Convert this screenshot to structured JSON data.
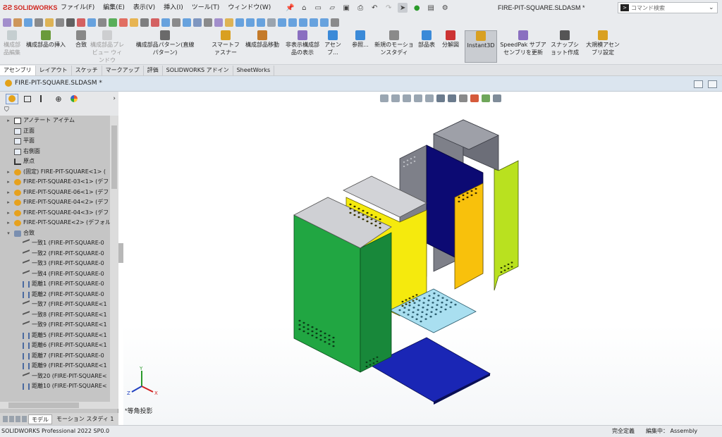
{
  "app": {
    "brand": "SOLIDWORKS",
    "doc_title": "FIRE-PIT-SQUARE.SLDASM *",
    "menus": [
      "ファイル(F)",
      "編集(E)",
      "表示(V)",
      "挿入(I)",
      "ツール(T)",
      "ウィンドウ(W)"
    ],
    "search_placeholder": "コマンド検索",
    "search_prefix": ">"
  },
  "command_manager": {
    "buttons": [
      {
        "label": "構成部品編集",
        "disabled": true
      },
      {
        "label": "構成部品の挿入",
        "disabled": false
      },
      {
        "label": "合致",
        "disabled": false
      },
      {
        "label": "構成部品プレビュー ウィンドウ",
        "disabled": true
      },
      {
        "label": "構成部品パターン(直線パターン)",
        "disabled": false
      },
      {
        "label": "スマートファスナー",
        "disabled": false
      },
      {
        "label": "構成部品移動",
        "disabled": false
      },
      {
        "label": "非表示構成部品の表示",
        "disabled": false
      },
      {
        "label": "アセンブ...",
        "disabled": false
      },
      {
        "label": "参照...",
        "disabled": false
      },
      {
        "label": "新規のモーションスタディ",
        "disabled": false
      },
      {
        "label": "部品表",
        "disabled": false
      },
      {
        "label": "分解図",
        "disabled": false
      },
      {
        "label": "Instant3D",
        "disabled": false,
        "active": true
      },
      {
        "label": "SpeedPak サブアセンブリを更新",
        "disabled": false
      },
      {
        "label": "スナップショット作成",
        "disabled": false
      },
      {
        "label": "大規模アセンブリ設定",
        "disabled": false
      }
    ],
    "tabs": [
      "アセンブリ",
      "レイアウト",
      "スケッチ",
      "マークアップ",
      "評価",
      "SOLIDWORKS アドイン",
      "SheetWorks"
    ],
    "active_tab": "アセンブリ"
  },
  "document_tab": {
    "label": "FIRE-PIT-SQUARE.SLDASM *"
  },
  "tree": {
    "items": [
      {
        "label": "アノテート アイテム",
        "level": 0,
        "expand": "▸",
        "icon": "annotation-icon"
      },
      {
        "label": "正面",
        "level": 0,
        "expand": "",
        "icon": "plane-icon"
      },
      {
        "label": "平面",
        "level": 0,
        "expand": "",
        "icon": "plane-icon"
      },
      {
        "label": "右側面",
        "level": 0,
        "expand": "",
        "icon": "plane-icon"
      },
      {
        "label": "原点",
        "level": 0,
        "expand": "",
        "icon": "origin-icon"
      },
      {
        "label": "(固定) FIRE-PIT-SQUARE<1> (",
        "level": 0,
        "expand": "▸",
        "icon": "part-icon"
      },
      {
        "label": "FIRE-PIT-SQUARE-03<1> (デフ",
        "level": 0,
        "expand": "▸",
        "icon": "part-icon"
      },
      {
        "label": "FIRE-PIT-SQUARE-06<1> (デフ",
        "level": 0,
        "expand": "▸",
        "icon": "part-icon"
      },
      {
        "label": "FIRE-PIT-SQUARE-04<2> (デフ",
        "level": 0,
        "expand": "▸",
        "icon": "part-icon"
      },
      {
        "label": "FIRE-PIT-SQUARE-04<3> (デフ",
        "level": 0,
        "expand": "▸",
        "icon": "part-icon"
      },
      {
        "label": "FIRE-PIT-SQUARE<2> (デフォルト",
        "level": 0,
        "expand": "▸",
        "icon": "part-icon"
      },
      {
        "label": "合致",
        "level": 0,
        "expand": "▾",
        "icon": "mates-icon"
      },
      {
        "label": "一致1 (FIRE-PIT-SQUARE-0",
        "level": 1,
        "expand": "",
        "icon": "coincident-icon"
      },
      {
        "label": "一致2 (FIRE-PIT-SQUARE-0",
        "level": 1,
        "expand": "",
        "icon": "coincident-icon"
      },
      {
        "label": "一致3 (FIRE-PIT-SQUARE-0",
        "level": 1,
        "expand": "",
        "icon": "coincident-icon"
      },
      {
        "label": "一致4 (FIRE-PIT-SQUARE-0",
        "level": 1,
        "expand": "",
        "icon": "coincident-icon"
      },
      {
        "label": "距離1 (FIRE-PIT-SQUARE-0",
        "level": 1,
        "expand": "",
        "icon": "distance-icon"
      },
      {
        "label": "距離2 (FIRE-PIT-SQUARE-0",
        "level": 1,
        "expand": "",
        "icon": "distance-icon"
      },
      {
        "label": "一致7 (FIRE-PIT-SQUARE<1",
        "level": 1,
        "expand": "",
        "icon": "coincident-icon"
      },
      {
        "label": "一致8 (FIRE-PIT-SQUARE<1",
        "level": 1,
        "expand": "",
        "icon": "coincident-icon"
      },
      {
        "label": "一致9 (FIRE-PIT-SQUARE<1",
        "level": 1,
        "expand": "",
        "icon": "coincident-icon"
      },
      {
        "label": "距離5 (FIRE-PIT-SQUARE<1",
        "level": 1,
        "expand": "",
        "icon": "distance-icon"
      },
      {
        "label": "距離6 (FIRE-PIT-SQUARE<1",
        "level": 1,
        "expand": "",
        "icon": "distance-icon"
      },
      {
        "label": "距離7 (FIRE-PIT-SQUARE-0",
        "level": 1,
        "expand": "",
        "icon": "distance-icon"
      },
      {
        "label": "距離9 (FIRE-PIT-SQUARE<1",
        "level": 1,
        "expand": "",
        "icon": "distance-icon"
      },
      {
        "label": "一致20 (FIRE-PIT-SQUARE<",
        "level": 1,
        "expand": "",
        "icon": "coincident-icon"
      },
      {
        "label": "距離10 (FIRE-PIT-SQUARE<",
        "level": 1,
        "expand": "",
        "icon": "distance-icon"
      }
    ]
  },
  "bottom_tabs": [
    "モデル",
    "モーション スタディ 1"
  ],
  "viewport": {
    "view_label": "*等角投影",
    "triad": {
      "x": "X",
      "y": "Y",
      "z": "Z"
    }
  },
  "status": {
    "product": "SOLIDWORKS Professional 2022 SP0.0",
    "state": "完全定義",
    "mode": "編集中： Assembly"
  },
  "colors": {
    "panel_green": "#21a642",
    "panel_yellow": "#f5ea0d",
    "panel_navy": "#0c0a73",
    "panel_orange": "#f8c10c",
    "panel_lime": "#b9e11f",
    "panel_gray": "#7e8089",
    "grate": "#a9dff0",
    "base_blue": "#1a26b5"
  }
}
